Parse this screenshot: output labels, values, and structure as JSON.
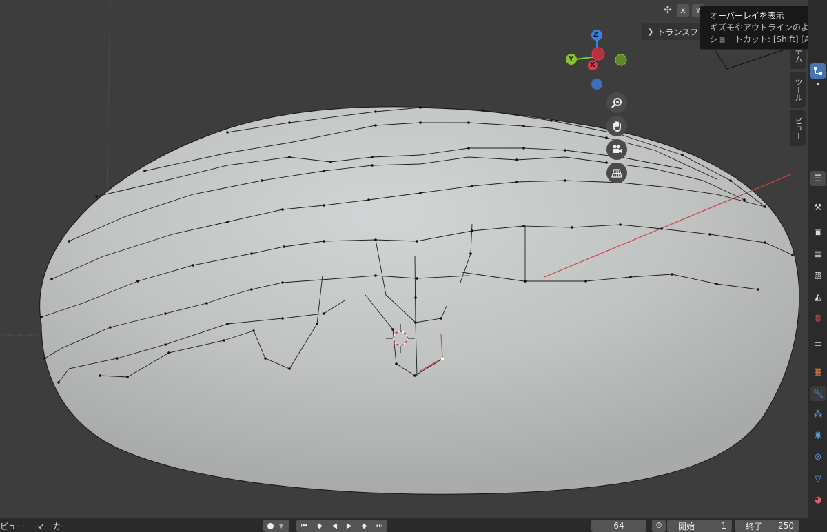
{
  "header": {
    "axis_x": "X",
    "axis_y": "Y"
  },
  "tooltip": {
    "title": "オーバーレイを表示",
    "description": "ギズモやアウトラインのような",
    "shortcut": "ショートカット: [Shift] [Alt] Z"
  },
  "sidebar_panel": {
    "transform_label": "トランスフ"
  },
  "side_tabs": {
    "item": "テム",
    "tool": "ツール",
    "view": "ビュー"
  },
  "gizmo": {
    "z": "Z",
    "y": "Y",
    "x": "X"
  },
  "timeline": {
    "menu_view": "ビュー",
    "menu_marker": "マーカー",
    "current_frame": "64",
    "start_label": "開始",
    "start_value": "1",
    "end_label": "終了",
    "end_value": "250"
  },
  "colors": {
    "viewport_bg": "#3d3d3d",
    "mesh_fill": "#c4c6c6",
    "axis_x": "#ee3344",
    "axis_y": "#86c332",
    "axis_z": "#3d7fd8",
    "selected_edge": "#d04a4a"
  }
}
